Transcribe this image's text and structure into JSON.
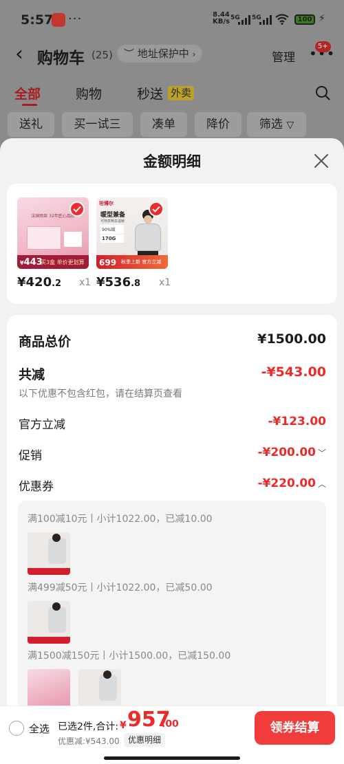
{
  "status_bar": {
    "time": "5:57",
    "overflow": "···",
    "net_speed_value": "8.44",
    "net_speed_unit": "KB/s",
    "sim1": "5G",
    "sim2": "5G",
    "battery": "100"
  },
  "header": {
    "title": "购物车",
    "count": "(25)",
    "address_label": "地址保护中",
    "manage_label": "管理",
    "badge": "5+"
  },
  "tabs": [
    {
      "label": "全部",
      "active": true
    },
    {
      "label": "购物",
      "active": false
    },
    {
      "label": "秒送",
      "active": false
    }
  ],
  "takeout_label": "外卖",
  "filters": [
    "送礼",
    "买一试三",
    "凑单",
    "降价",
    "筛选"
  ],
  "sheet": {
    "title": "金额明细",
    "goods": [
      {
        "price_int": "¥420",
        "price_dec": ".2",
        "qty": "x1",
        "thumb_title": "法国明显 32年匠心品质",
        "thumb_price": "443",
        "thumb_bottom": "买3盒 单价更划算"
      },
      {
        "price_int": "¥536",
        "price_dec": ".8",
        "qty": "x1",
        "thumb_brand": "坦博尔",
        "thumb_title": "暖型兼备",
        "thumb_sub": "可随意畅享温暖",
        "thumb_fill": "90%绒",
        "thumb_weight": "170G",
        "thumb_price": "699",
        "thumb_bottom": "秋季上新 官方立减"
      }
    ],
    "summary": {
      "total_label": "商品总价",
      "total_value": "¥1500.00",
      "reduce_label": "共减",
      "reduce_value": "-¥543.00",
      "note": "以下优惠不包含红包，请在结算页查看",
      "official_label": "官方立减",
      "official_value": "-¥123.00",
      "promo_label": "促销",
      "promo_value": "-¥200.00",
      "coupon_label": "优惠券",
      "coupon_value": "-¥220.00"
    },
    "coupons": [
      {
        "text": "满100减10元丨小计1022.00，已减10.00"
      },
      {
        "text": "满499减50元丨小计1022.00，已减50.00"
      },
      {
        "text": "满1500减150元丨小计1500.00，已减150.00"
      }
    ]
  },
  "bottom_bar": {
    "select_all": "全选",
    "selected_info": "已选2件,合计:",
    "currency": "¥",
    "total_int": "957",
    "total_dec": ".00",
    "discount_text": "优惠减:¥543.00",
    "detail_button": "优惠明细",
    "checkout_button": "领券结算"
  },
  "colors": {
    "accent_red": "#ec2a2a",
    "checkout_red": "#f23b3b",
    "sheet_bg": "#f2f2f2"
  }
}
